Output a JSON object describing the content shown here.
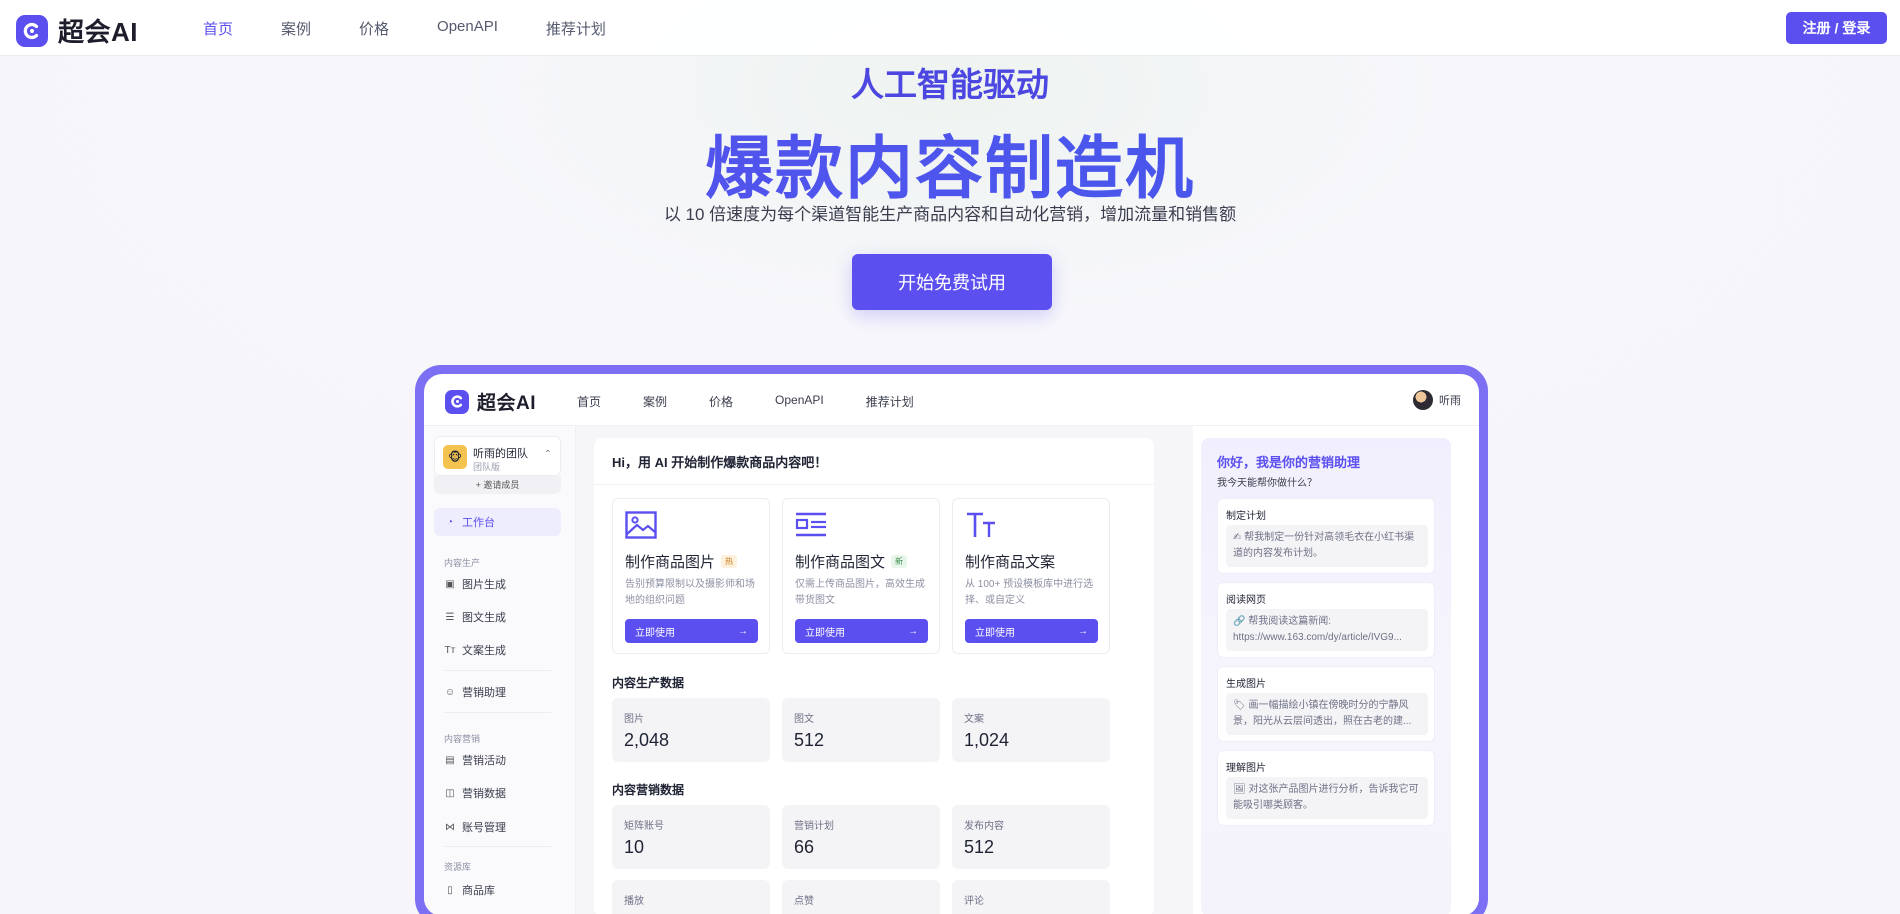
{
  "brand": {
    "name": "超会AI",
    "accent": "#5b4ff0"
  },
  "topnav": {
    "links": [
      "首页",
      "案例",
      "价格",
      "OpenAPI",
      "推荐计划"
    ],
    "active": "首页",
    "login_label": "注册 / 登录"
  },
  "hero": {
    "kicker": "人工智能驱动",
    "title": "爆款内容制造机",
    "subtitle": "以 10 倍速度为每个渠道智能生产商品内容和自动化营销，增加流量和销售额",
    "cta_label": "开始免费试用"
  },
  "app": {
    "brand": "超会AI",
    "nav": [
      "首页",
      "案例",
      "价格",
      "OpenAPI",
      "推荐计划"
    ],
    "user_name": "听雨",
    "team": {
      "name": "听雨的团队",
      "plan": "团队版",
      "invite": "+ 邀请成员"
    },
    "sidebar": {
      "workbench": "工作台",
      "group_production": "内容生产",
      "image_gen": "图片生成",
      "post_gen": "图文生成",
      "copy_gen": "文案生成",
      "assistant": "营销助理",
      "group_marketing": "内容营销",
      "campaign": "营销活动",
      "marketing_data": "营销数据",
      "accounts": "账号管理",
      "group_resources": "资源库",
      "products": "商品库"
    },
    "main": {
      "greeting": "Hi，用 AI 开始制作爆款商品内容吧！",
      "features": [
        {
          "title": "制作商品图片",
          "badge": "热",
          "desc": "告别预算限制以及摄影师和场地的组织问题",
          "button": "立即使用"
        },
        {
          "title": "制作商品图文",
          "badge": "新",
          "desc": "仅需上传商品图片，高效生成带货图文",
          "button": "立即使用"
        },
        {
          "title": "制作商品文案",
          "badge": "",
          "desc": "从 100+ 预设模板库中进行选择、或自定义",
          "button": "立即使用"
        }
      ],
      "production_title": "内容生产数据",
      "production_stats": [
        {
          "label": "图片",
          "value": "2,048"
        },
        {
          "label": "图文",
          "value": "512"
        },
        {
          "label": "文案",
          "value": "1,024"
        }
      ],
      "marketing_title": "内容营销数据",
      "marketing_stats": [
        {
          "label": "矩阵账号",
          "value": "10"
        },
        {
          "label": "营销计划",
          "value": "66"
        },
        {
          "label": "发布内容",
          "value": "512"
        }
      ],
      "engagement_stats": [
        {
          "label": "播放",
          "value": ""
        },
        {
          "label": "点赞",
          "value": ""
        },
        {
          "label": "评论",
          "value": ""
        }
      ]
    },
    "assistant": {
      "title": "你好，我是你的营销助理",
      "subtitle": "我今天能帮你做什么？",
      "tasks": [
        {
          "title": "制定计划",
          "body": "✍ 帮我制定一份针对高领毛衣在小红书渠道的内容发布计划。"
        },
        {
          "title": "阅读网页",
          "body": "🔗 帮我阅读这篇新闻: https://www.163.com/dy/article/IVG9..."
        },
        {
          "title": "生成图片",
          "body": "🏷 画一幅描绘小镇在傍晚时分的宁静风景，阳光从云层间透出，照在古老的建..."
        },
        {
          "title": "理解图片",
          "body": "🖼 对这张产品图片进行分析，告诉我它可能吸引哪类顾客。"
        }
      ]
    }
  }
}
